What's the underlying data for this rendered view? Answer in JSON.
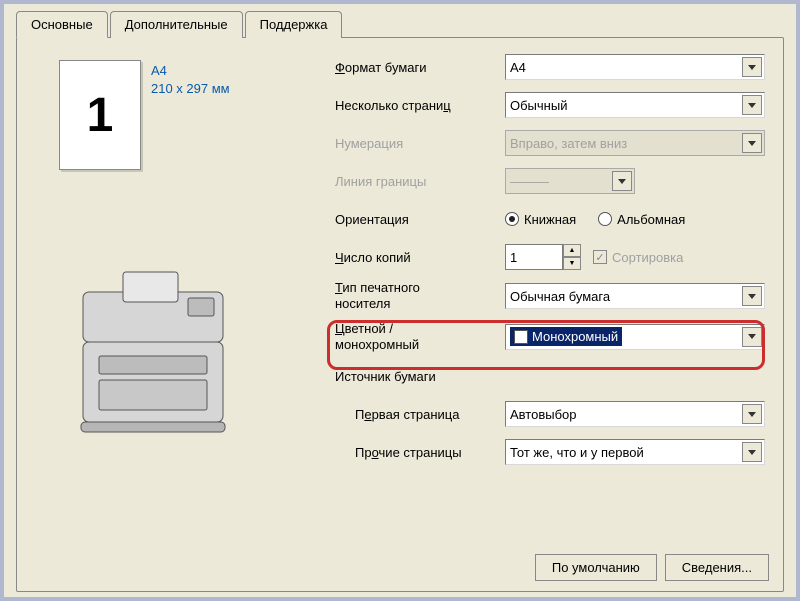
{
  "tabs": {
    "main": "Основные",
    "extra": "Дополнительные",
    "support": "Поддержка"
  },
  "preview": {
    "page_number": "1",
    "format_name": "A4",
    "dimensions": "210 x 297 мм"
  },
  "labels": {
    "paper_format": "Формат бумаги",
    "multi_page": "Несколько страниц",
    "numbering": "Нумерация",
    "border_lines": "Линия границы",
    "orientation": "Ориентация",
    "copies": "Число копий",
    "media_type": "Тип печатного носителя",
    "color_mode": "Цветной / монохромный",
    "paper_source": "Источник бумаги",
    "first_page": "Первая страница",
    "other_pages": "Прочие страницы"
  },
  "values": {
    "paper_format": "A4",
    "multi_page": "Обычный",
    "numbering": "Вправо, затем вниз",
    "orientation_portrait": "Книжная",
    "orientation_landscape": "Альбомная",
    "copies": "1",
    "collate": "Сортировка",
    "media_type": "Обычная бумага",
    "color_mode": "Монохромный",
    "first_page": "Автовыбор",
    "other_pages": "Тот же, что и у первой"
  },
  "buttons": {
    "defaults": "По умолчанию",
    "about": "Сведения..."
  }
}
